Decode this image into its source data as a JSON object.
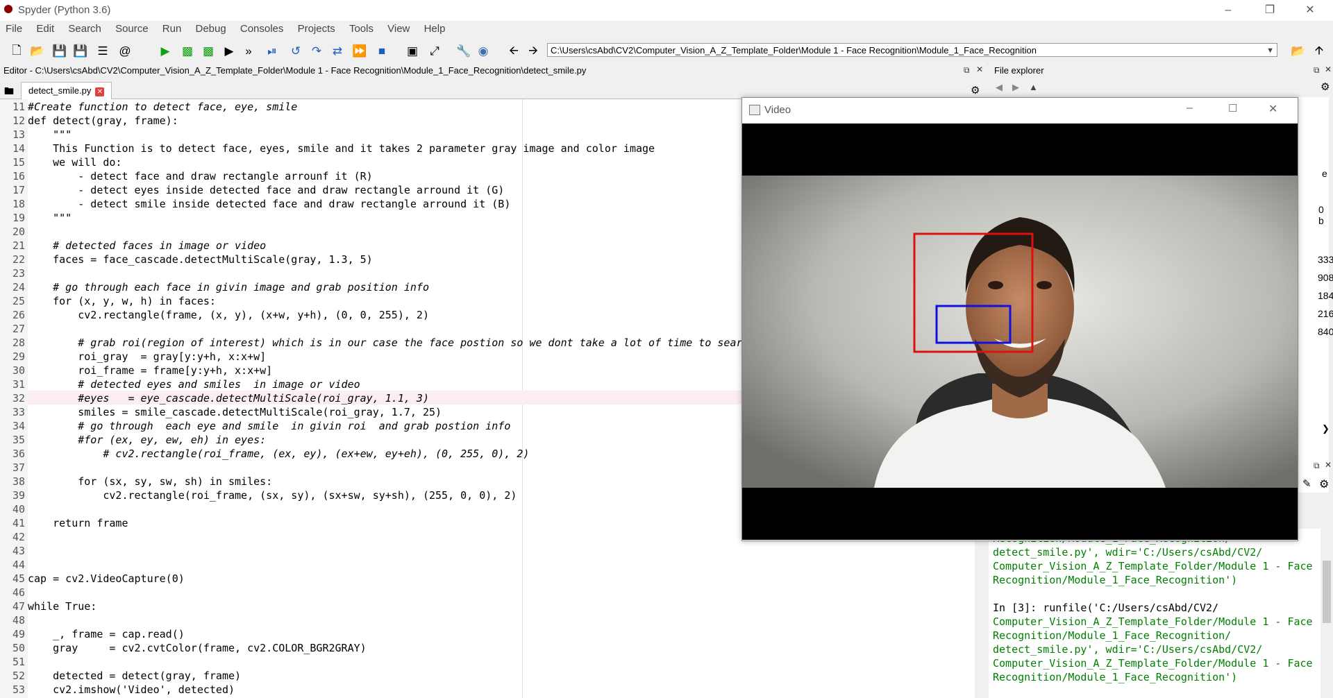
{
  "window": {
    "title": "Spyder (Python 3.6)"
  },
  "menu": [
    "File",
    "Edit",
    "Search",
    "Source",
    "Run",
    "Debug",
    "Consoles",
    "Projects",
    "Tools",
    "View",
    "Help"
  ],
  "toolbar": {
    "path": "C:\\Users\\csAbd\\CV2\\Computer_Vision_A_Z_Template_Folder\\Module 1 - Face Recognition\\Module_1_Face_Recognition",
    "more_label": "»"
  },
  "editor": {
    "header": "Editor - C:\\Users\\csAbd\\CV2\\Computer_Vision_A_Z_Template_Folder\\Module 1 - Face Recognition\\Module_1_Face_Recognition\\detect_smile.py",
    "tab": "detect_smile.py",
    "lines": [
      {
        "n": "11",
        "t": "#Create function to detect face, eye, smile"
      },
      {
        "n": "12",
        "t": "def detect(gray, frame):"
      },
      {
        "n": "13",
        "t": "    \"\"\""
      },
      {
        "n": "14",
        "t": "    This Function is to detect face, eyes, smile and it takes 2 parameter gray image and color image"
      },
      {
        "n": "15",
        "t": "    we will do:"
      },
      {
        "n": "16",
        "t": "        - detect face and draw rectangle arrounf it (R)"
      },
      {
        "n": "17",
        "t": "        - detect eyes inside detected face and draw rectangle arround it (G)"
      },
      {
        "n": "18",
        "t": "        - detect smile inside detected face and draw rectangle arround it (B)"
      },
      {
        "n": "19",
        "t": "    \"\"\""
      },
      {
        "n": "20",
        "t": ""
      },
      {
        "n": "21",
        "t": "    # detected faces in image or video"
      },
      {
        "n": "22",
        "t": "    faces = face_cascade.detectMultiScale(gray, 1.3, 5)"
      },
      {
        "n": "23",
        "t": ""
      },
      {
        "n": "24",
        "t": "    # go through each face in givin image and grab position info"
      },
      {
        "n": "25",
        "t": "    for (x, y, w, h) in faces:"
      },
      {
        "n": "26",
        "t": "        cv2.rectangle(frame, (x, y), (x+w, y+h), (0, 0, 255), 2)"
      },
      {
        "n": "27",
        "t": ""
      },
      {
        "n": "28",
        "t": "        # grab roi(region of interest) which is in our case the face postion so we dont take a lot of time to sear"
      },
      {
        "n": "29",
        "t": "        roi_gray  = gray[y:y+h, x:x+w]"
      },
      {
        "n": "30",
        "t": "        roi_frame = frame[y:y+h, x:x+w]"
      },
      {
        "n": "31",
        "t": "        # detected eyes and smiles  in image or video"
      },
      {
        "n": "32",
        "t": "        #eyes   = eye_cascade.detectMultiScale(roi_gray, 1.1, 3)"
      },
      {
        "n": "33",
        "t": "        smiles = smile_cascade.detectMultiScale(roi_gray, 1.7, 25)"
      },
      {
        "n": "34",
        "t": "        # go through  each eye and smile  in givin roi  and grab postion info"
      },
      {
        "n": "35",
        "t": "        #for (ex, ey, ew, eh) in eyes:"
      },
      {
        "n": "36",
        "t": "            # cv2.rectangle(roi_frame, (ex, ey), (ex+ew, ey+eh), (0, 255, 0), 2)"
      },
      {
        "n": "37",
        "t": ""
      },
      {
        "n": "38",
        "t": "        for (sx, sy, sw, sh) in smiles:"
      },
      {
        "n": "39",
        "t": "            cv2.rectangle(roi_frame, (sx, sy), (sx+sw, sy+sh), (255, 0, 0), 2)"
      },
      {
        "n": "40",
        "t": ""
      },
      {
        "n": "41",
        "t": "    return frame"
      },
      {
        "n": "42",
        "t": ""
      },
      {
        "n": "43",
        "t": ""
      },
      {
        "n": "44",
        "t": ""
      },
      {
        "n": "45",
        "t": "cap = cv2.VideoCapture(0)"
      },
      {
        "n": "46",
        "t": ""
      },
      {
        "n": "47",
        "t": "while True:"
      },
      {
        "n": "48",
        "t": ""
      },
      {
        "n": "49",
        "t": "    _, frame = cap.read()"
      },
      {
        "n": "50",
        "t": "    gray     = cv2.cvtColor(frame, cv2.COLOR_BGR2GRAY)"
      },
      {
        "n": "51",
        "t": ""
      },
      {
        "n": "52",
        "t": "    detected = detect(gray, frame)"
      },
      {
        "n": "53",
        "t": "    cv2.imshow('Video', detected)"
      }
    ]
  },
  "file_explorer": {
    "title": "File explorer",
    "partial_values": [
      "e",
      "0 b",
      "333",
      "908",
      "184",
      "216",
      "840"
    ]
  },
  "console": {
    "lines": [
      {
        "t": "Computer_Vision_A_Z_Template_Folder/Module 1 - Face",
        "c": "green"
      },
      {
        "t": "Recognition/Module_1_Face_Recognition/",
        "c": "green"
      },
      {
        "t": "detect_smile.py', wdir='C:/Users/csAbd/CV2/",
        "c": "mixed1"
      },
      {
        "t": "Computer_Vision_A_Z_Template_Folder/Module 1 - Face",
        "c": "green"
      },
      {
        "t": "Recognition/Module_1_Face_Recognition')",
        "c": "mixed2"
      },
      {
        "t": "",
        "c": "black"
      },
      {
        "t": "In [3]: runfile('C:/Users/csAbd/CV2/",
        "c": "mixed3"
      },
      {
        "t": "Computer_Vision_A_Z_Template_Folder/Module 1 - Face",
        "c": "green"
      },
      {
        "t": "Recognition/Module_1_Face_Recognition/",
        "c": "green"
      },
      {
        "t": "detect_smile.py', wdir='C:/Users/csAbd/CV2/",
        "c": "mixed1"
      },
      {
        "t": "Computer_Vision_A_Z_Template_Folder/Module 1 - Face",
        "c": "green"
      },
      {
        "t": "Recognition/Module_1_Face_Recognition')",
        "c": "mixed2"
      }
    ]
  },
  "video_window": {
    "title": "Video",
    "face_box_color": "#e01010",
    "smile_box_color": "#1010e0"
  }
}
